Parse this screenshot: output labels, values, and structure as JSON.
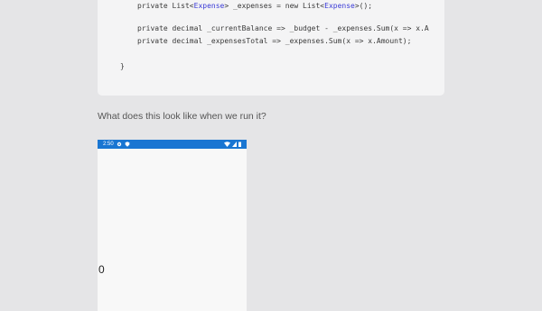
{
  "code": {
    "line1_prefix": "private List<",
    "line1_type1": "Expense",
    "line1_mid": "> _expenses = new List<",
    "line1_type2": "Expense",
    "line1_suffix": ">();",
    "line2": "private decimal _currentBalance => _budget - _expenses.Sum(x => x.A",
    "line3": "private decimal _expensesTotal => _expenses.Sum(x => x.Amount);",
    "closing_brace": "}"
  },
  "prose": {
    "question": "What does this look like when we run it?"
  },
  "phone": {
    "status_time": "2:50",
    "balance_value": "0",
    "statusbar_color": "#1976d2",
    "icons": [
      "settings-icon",
      "shield-icon",
      "wifi-icon",
      "signal-icon",
      "battery-icon"
    ]
  }
}
